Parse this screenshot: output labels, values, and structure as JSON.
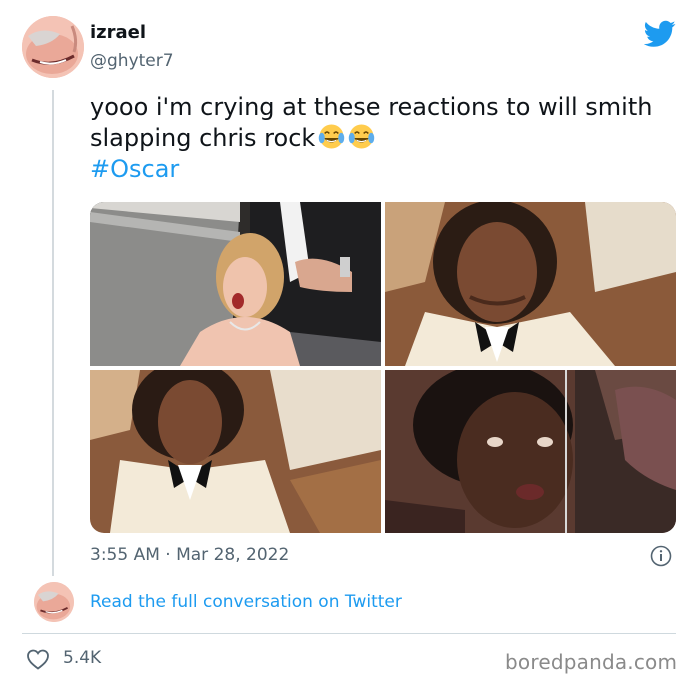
{
  "tweet": {
    "display_name": "izrael",
    "handle": "@ghyter7",
    "text": "yooo i'm crying at these reactions to will smith slapping chris rock",
    "emojis": [
      "face-with-tears-of-joy",
      "face-with-tears-of-joy"
    ],
    "hashtag": "#Oscar",
    "timestamp": "3:55 AM · Mar 28, 2022",
    "read_link": "Read the full conversation on Twitter",
    "likes": "5.4K"
  },
  "media": {
    "photos": [
      {
        "subject": "woman-gasping-in-audience"
      },
      {
        "subject": "man-in-white-tuxedo-frowning"
      },
      {
        "subject": "man-in-white-tuxedo-staring"
      },
      {
        "subject": "woman-looking-surprised"
      }
    ]
  },
  "icons": {
    "brand": "twitter-bird-icon",
    "info": "info-icon",
    "like": "heart-icon"
  },
  "colors": {
    "link": "#1d9bf0",
    "text": "#0f1419",
    "secondary": "#536471",
    "divider": "#cfd9de"
  },
  "watermark": "boredpanda.com"
}
